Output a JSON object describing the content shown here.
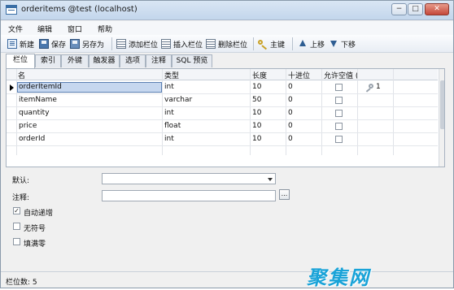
{
  "window": {
    "title": "orderitems @test (localhost)",
    "controls": [
      "−",
      "□",
      "✕"
    ]
  },
  "menu": [
    "文件",
    "编辑",
    "窗口",
    "帮助"
  ],
  "toolbar": {
    "new": "新建",
    "save": "保存",
    "save_as": "另存为",
    "add_field": "添加栏位",
    "insert_field": "插入栏位",
    "delete_field": "删除栏位",
    "primary_key": "主键",
    "move_up": "上移",
    "move_down": "下移"
  },
  "tabs": [
    "栏位",
    "索引",
    "外键",
    "触发器",
    "选项",
    "注释",
    "SQL 预览"
  ],
  "active_tab": "栏位",
  "grid": {
    "columns": [
      "名",
      "类型",
      "长度",
      "十进位",
      "允许空值 (",
      ""
    ],
    "rows": [
      {
        "name": "orderItemId",
        "type": "int",
        "length": "10",
        "decimals": "0",
        "allow_null": false,
        "key": "1",
        "selected": true
      },
      {
        "name": "itemName",
        "type": "varchar",
        "length": "50",
        "decimals": "0",
        "allow_null": false,
        "key": "",
        "selected": false
      },
      {
        "name": "quantity",
        "type": "int",
        "length": "10",
        "decimals": "0",
        "allow_null": false,
        "key": "",
        "selected": false
      },
      {
        "name": "price",
        "type": "float",
        "length": "10",
        "decimals": "0",
        "allow_null": false,
        "key": "",
        "selected": false
      },
      {
        "name": "orderId",
        "type": "int",
        "length": "10",
        "decimals": "0",
        "allow_null": false,
        "key": "",
        "selected": false
      }
    ]
  },
  "properties": {
    "default_label": "默认:",
    "default_value": "",
    "comment_label": "注释:",
    "comment_value": "",
    "ellipsis": "...",
    "auto_increment_label": "自动递增",
    "auto_increment": true,
    "unsigned_label": "无符号",
    "unsigned": false,
    "zerofill_label": "填满零",
    "zerofill": false
  },
  "status": {
    "field_count": "栏位数: 5"
  },
  "watermark": "聚集网"
}
